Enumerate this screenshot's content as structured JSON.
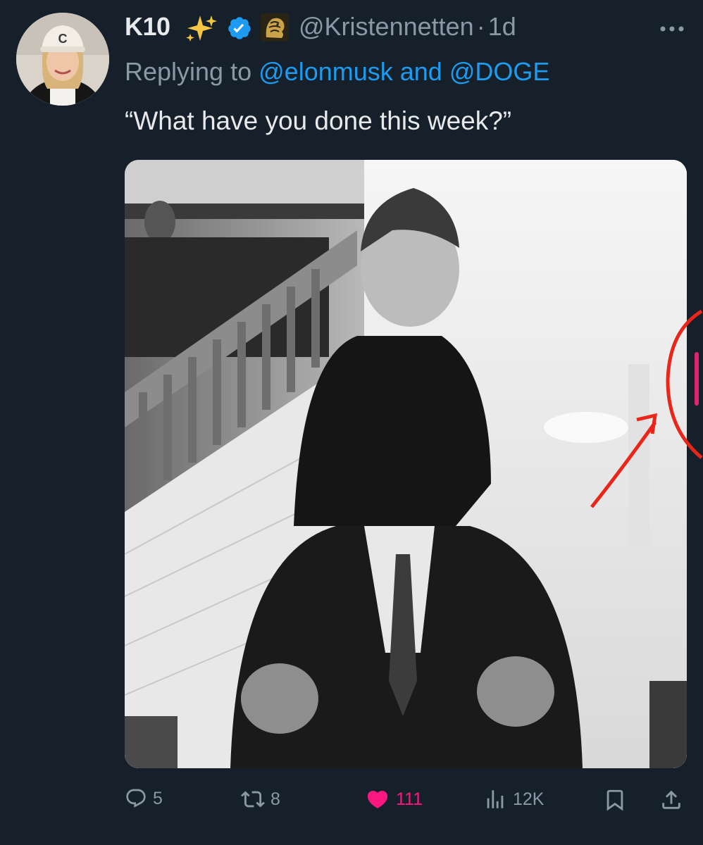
{
  "tweet": {
    "author_name": "K10",
    "handle": "@Kristennetten",
    "separator": "·",
    "time": "1d",
    "replying_prefix": "Replying to",
    "replying_mention_1": "@elonmusk",
    "replying_and": "and",
    "replying_mention_2": "@DOGE",
    "text": "“What have you done this week?”",
    "avatar_cap_letter": "C"
  },
  "actions": {
    "replies": "5",
    "reposts": "8",
    "likes": "111",
    "views": "12K"
  },
  "icons": {
    "sparkles": "sparkles-icon",
    "verified": "verified-badge-icon",
    "affiliate": "lion-affiliate-icon",
    "more": "more-icon",
    "reply": "reply-icon",
    "repost": "repost-icon",
    "like": "heart-icon",
    "views": "views-icon",
    "bookmark": "bookmark-icon",
    "share": "share-icon"
  },
  "colors": {
    "background": "#15202b",
    "text": "#e7e9ea",
    "muted": "#8b98a5",
    "link": "#1d9bf0",
    "like": "#f91880",
    "annotation": "#e8261a"
  }
}
